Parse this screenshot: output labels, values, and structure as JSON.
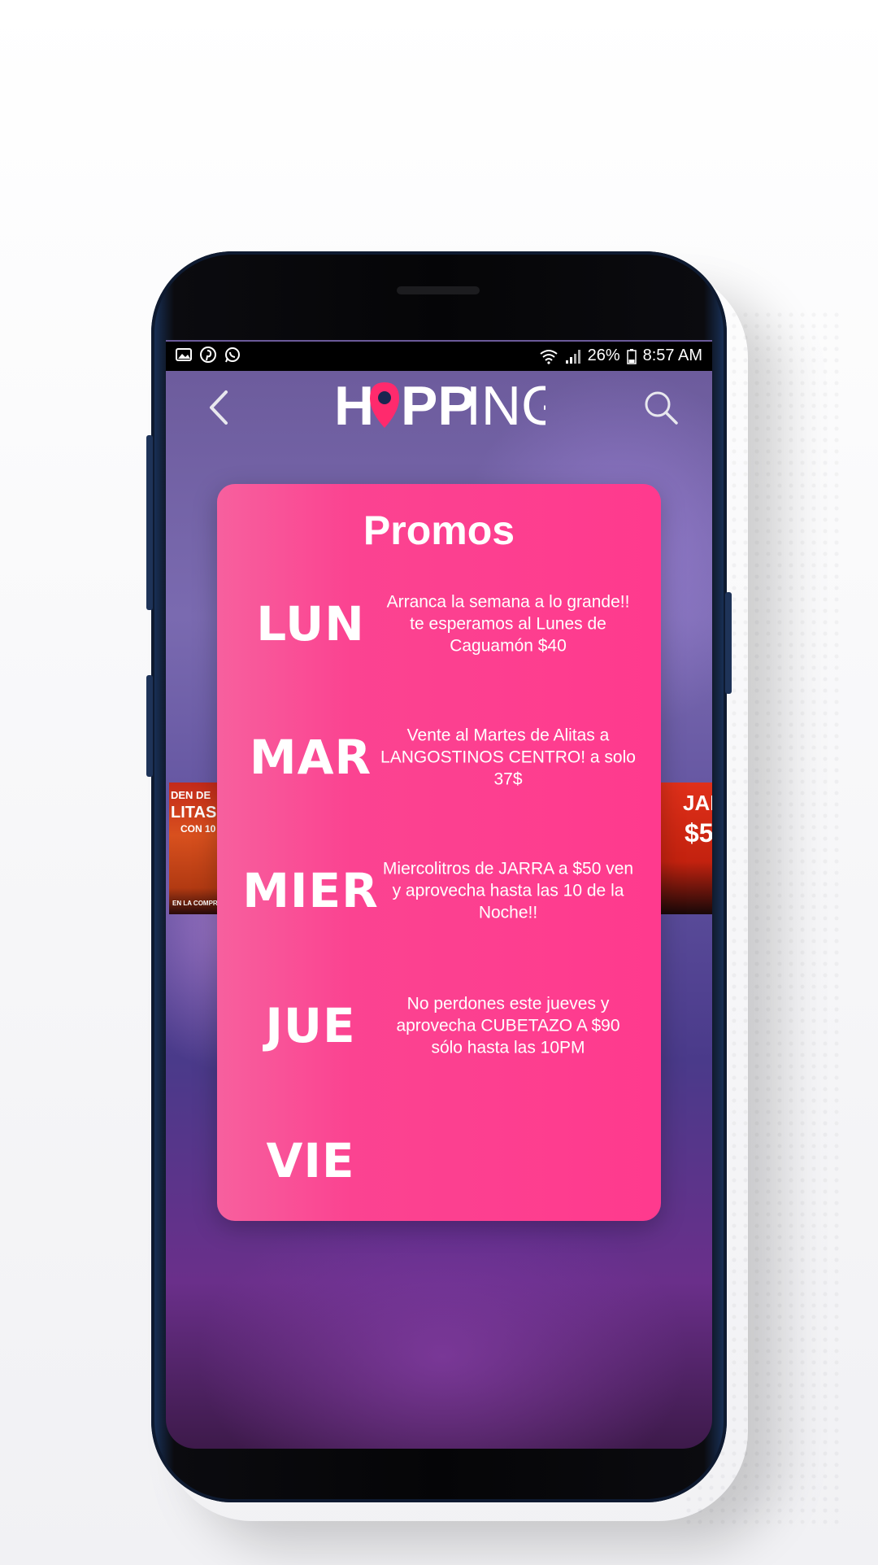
{
  "status_bar": {
    "battery": "26%",
    "time": "8:57 AM",
    "left_icons": [
      "gallery-icon",
      "pinterest-icon",
      "whatsapp-icon"
    ],
    "right_icons": [
      "wifi-icon",
      "signal-icon",
      "battery-icon"
    ]
  },
  "app_bar": {
    "logo_text_1": "H",
    "logo_text_2": "PP",
    "logo_text_3": "ING",
    "back_icon": "chevron-left-icon",
    "search_icon": "search-icon"
  },
  "background_thumbs": {
    "left_lines": [
      "DEN DE",
      "LITAS",
      "CON 10",
      "EN LA COMPRA"
    ],
    "right_lines": [
      "JAR",
      "$5"
    ]
  },
  "modal": {
    "title": "Promos",
    "promos": [
      {
        "day": "LUN",
        "text": "Arranca la semana a lo grande!! te esperamos al Lunes de Caguamón $40"
      },
      {
        "day": "MAR",
        "text": "Vente al Martes de Alitas a LANGOSTINOS CENTRO! a solo 37$"
      },
      {
        "day": "MIER",
        "text": "Miercolitros de JARRA a $50 ven y aprovecha hasta las 10 de la Noche!!"
      },
      {
        "day": "JUE",
        "text": "No perdones este jueves y aprovecha CUBETAZO A $90 sólo hasta las 10PM"
      },
      {
        "day": "VIE",
        "text": ""
      }
    ]
  },
  "colors": {
    "modal_pink": "#ff3a8e",
    "logo_pin": "#ff2a6d",
    "status_bar": "#000000"
  }
}
